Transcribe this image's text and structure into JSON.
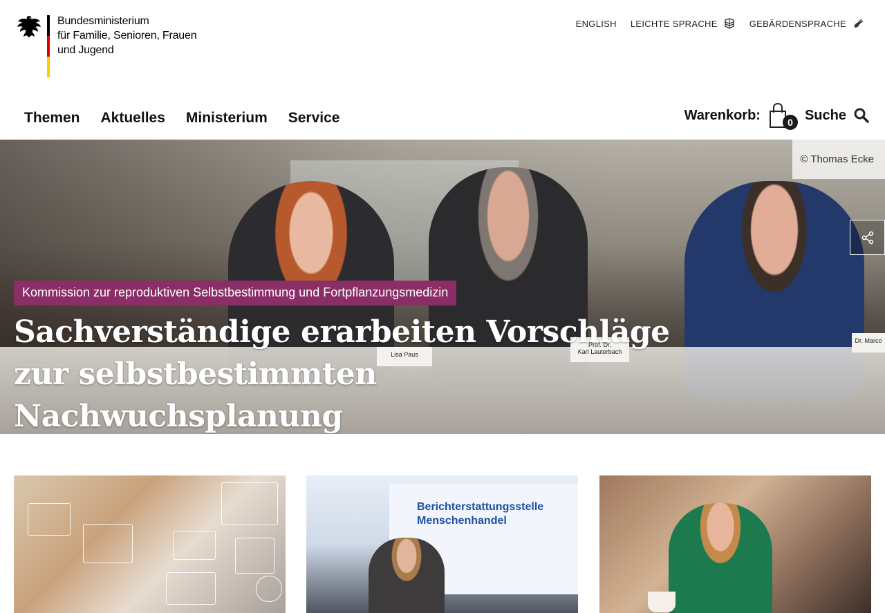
{
  "logo": {
    "lines": [
      "Bundesministerium",
      "für Familie, Senioren, Frauen",
      "und Jugend"
    ]
  },
  "lang_links": {
    "english": "ENGLISH",
    "leichte_sprache": "LEICHTE SPRACHE",
    "gebaerdensprache": "GEBÄRDENSPRACHE"
  },
  "nav": {
    "items": [
      {
        "label": "Themen"
      },
      {
        "label": "Aktuelles"
      },
      {
        "label": "Ministerium"
      },
      {
        "label": "Service"
      }
    ]
  },
  "util": {
    "cart_label": "Warenkorb:",
    "cart_count": "0",
    "search_label": "Suche"
  },
  "hero": {
    "credit": "© Thomas Ecke",
    "kicker": "Kommission zur reproduktiven Selbstbestimmung und Fortpflanzungsmedizin",
    "headline": "Sachverständige erarbeiten Vorschläge zur selbstbestimmten Nachwuchsplanung",
    "nameplates": [
      "Lisa Paus",
      "Prof. Dr.\nKarl Lauterbach",
      "Dr. Marco"
    ]
  },
  "cards": [
    {
      "image": "digital-data-keyboard"
    },
    {
      "image": "speaker-berichterstattungsstelle",
      "screen_text": "Berichterstattungsstelle\nMenschenhandel"
    },
    {
      "image": "minister-cafe"
    }
  ],
  "colors": {
    "kicker_bg": "#8b2e67",
    "headline": "#ffffff",
    "flag_black": "#000000",
    "flag_red": "#dd0000",
    "flag_gold": "#ffcc00"
  }
}
